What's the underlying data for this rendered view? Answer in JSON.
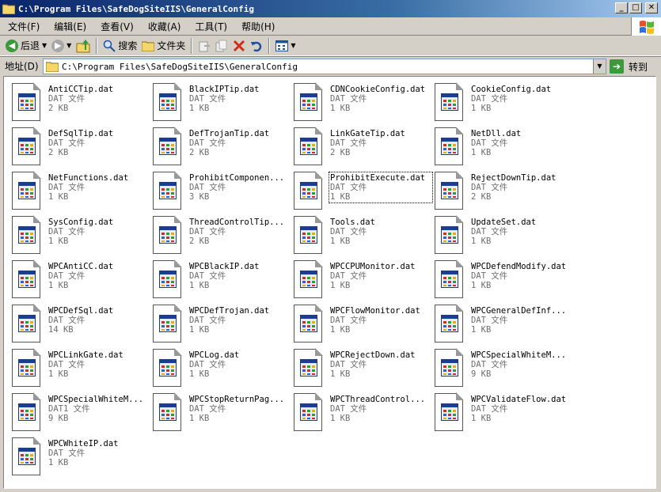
{
  "window": {
    "title": "C:\\Program Files\\SafeDogSiteIIS\\GeneralConfig",
    "buttons": {
      "minimize": "_",
      "maximize": "□",
      "close": "✕"
    }
  },
  "menu": [
    {
      "label": "文件(F)"
    },
    {
      "label": "编辑(E)"
    },
    {
      "label": "查看(V)"
    },
    {
      "label": "收藏(A)"
    },
    {
      "label": "工具(T)"
    },
    {
      "label": "帮助(H)"
    }
  ],
  "toolbar": {
    "back_label": "后退",
    "search_label": "搜索",
    "folders_label": "文件夹"
  },
  "address": {
    "label": "地址(D)",
    "path": "C:\\Program Files\\SafeDogSiteIIS\\GeneralConfig",
    "go_label": "转到"
  },
  "files": [
    {
      "name": "AntiCCTip.dat",
      "type": "DAT 文件",
      "size": "2 KB"
    },
    {
      "name": "BlackIPTip.dat",
      "type": "DAT 文件",
      "size": "1 KB"
    },
    {
      "name": "CDNCookieConfig.dat",
      "type": "DAT 文件",
      "size": "1 KB"
    },
    {
      "name": "CookieConfig.dat",
      "type": "DAT 文件",
      "size": "1 KB"
    },
    {
      "name": "DefSqlTip.dat",
      "type": "DAT 文件",
      "size": "2 KB"
    },
    {
      "name": "DefTrojanTip.dat",
      "type": "DAT 文件",
      "size": "2 KB"
    },
    {
      "name": "LinkGateTip.dat",
      "type": "DAT 文件",
      "size": "2 KB"
    },
    {
      "name": "NetDll.dat",
      "type": "DAT 文件",
      "size": "1 KB"
    },
    {
      "name": "NetFunctions.dat",
      "type": "DAT 文件",
      "size": "1 KB"
    },
    {
      "name": "ProhibitComponen...",
      "type": "DAT 文件",
      "size": "3 KB"
    },
    {
      "name": "ProhibitExecute.dat",
      "type": "DAT 文件",
      "size": "1 KB"
    },
    {
      "name": "RejectDownTip.dat",
      "type": "DAT 文件",
      "size": "2 KB"
    },
    {
      "name": "SysConfig.dat",
      "type": "DAT 文件",
      "size": "1 KB"
    },
    {
      "name": "ThreadControlTip...",
      "type": "DAT 文件",
      "size": "2 KB"
    },
    {
      "name": "Tools.dat",
      "type": "DAT 文件",
      "size": "1 KB"
    },
    {
      "name": "UpdateSet.dat",
      "type": "DAT 文件",
      "size": "1 KB"
    },
    {
      "name": "WPCAntiCC.dat",
      "type": "DAT 文件",
      "size": "1 KB"
    },
    {
      "name": "WPCBlackIP.dat",
      "type": "DAT 文件",
      "size": "1 KB"
    },
    {
      "name": "WPCCPUMonitor.dat",
      "type": "DAT 文件",
      "size": "1 KB"
    },
    {
      "name": "WPCDefendModify.dat",
      "type": "DAT 文件",
      "size": "1 KB"
    },
    {
      "name": "WPCDefSql.dat",
      "type": "DAT 文件",
      "size": "14 KB"
    },
    {
      "name": "WPCDefTrojan.dat",
      "type": "DAT 文件",
      "size": "1 KB"
    },
    {
      "name": "WPCFlowMonitor.dat",
      "type": "DAT 文件",
      "size": "1 KB"
    },
    {
      "name": "WPCGeneralDefInf...",
      "type": "DAT 文件",
      "size": "1 KB"
    },
    {
      "name": "WPCLinkGate.dat",
      "type": "DAT 文件",
      "size": "1 KB"
    },
    {
      "name": "WPCLog.dat",
      "type": "DAT 文件",
      "size": "1 KB"
    },
    {
      "name": "WPCRejectDown.dat",
      "type": "DAT 文件",
      "size": "1 KB"
    },
    {
      "name": "WPCSpecialWhiteM...",
      "type": "DAT 文件",
      "size": "9 KB"
    },
    {
      "name": "WPCSpecialWhiteM...",
      "type": "DAT1 文件",
      "size": "9 KB"
    },
    {
      "name": "WPCStopReturnPag...",
      "type": "DAT 文件",
      "size": "1 KB"
    },
    {
      "name": "WPCThreadControl...",
      "type": "DAT 文件",
      "size": "1 KB"
    },
    {
      "name": "WPCValidateFlow.dat",
      "type": "DAT 文件",
      "size": "1 KB"
    },
    {
      "name": "WPCWhiteIP.dat",
      "type": "DAT 文件",
      "size": "1 KB"
    }
  ],
  "focused_index": 10
}
